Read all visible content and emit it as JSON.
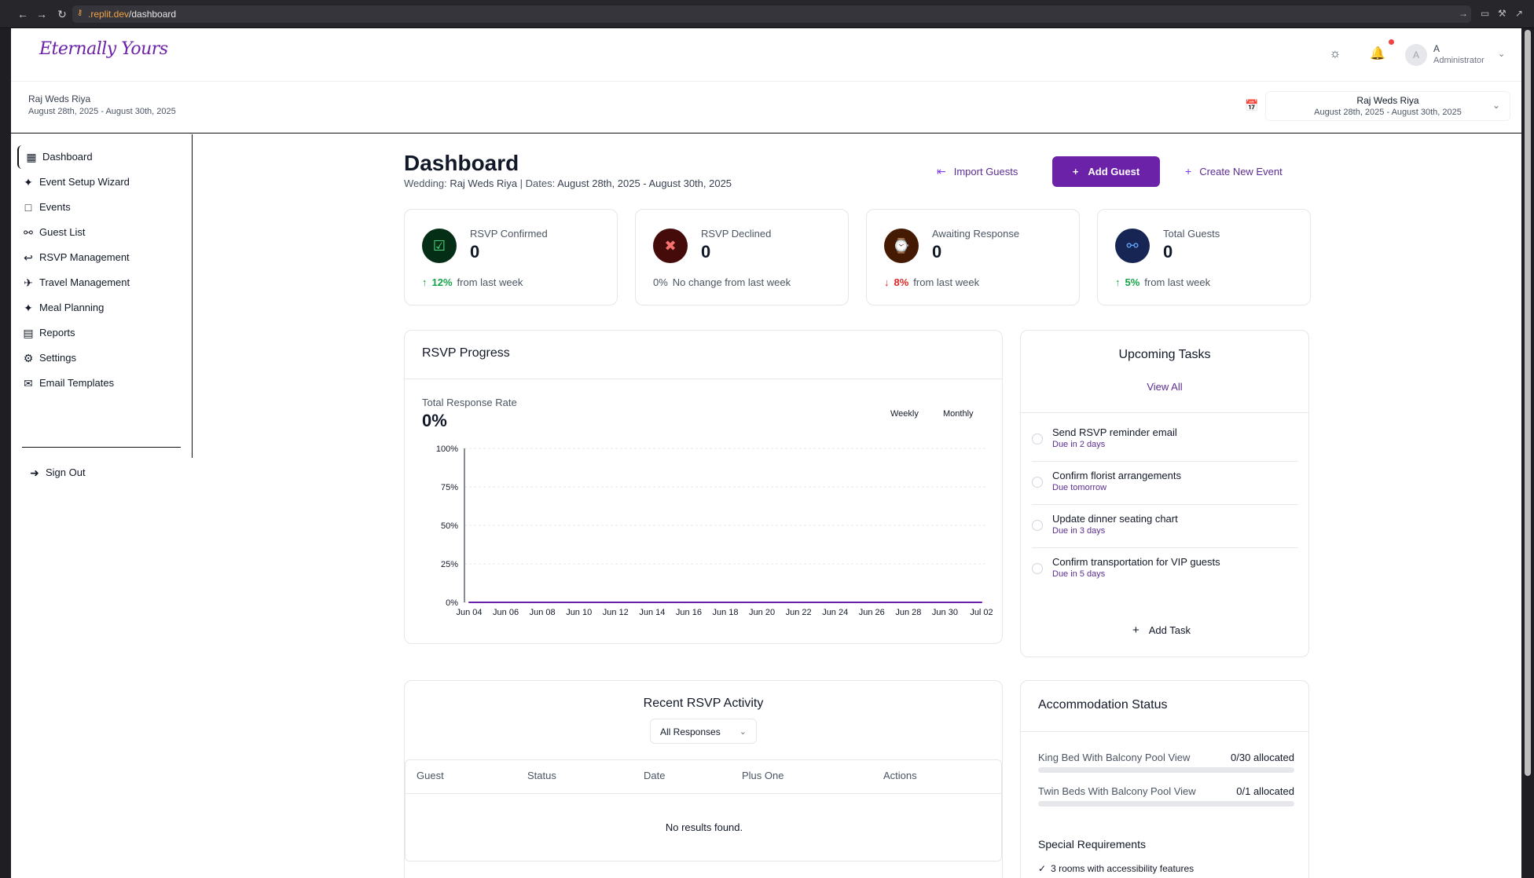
{
  "browser": {
    "url_domain": ".replit.dev",
    "url_path": "/dashboard"
  },
  "header": {
    "logo": "Eternally Yours",
    "user_initial": "A",
    "user_name": "A",
    "user_role": "Administrator"
  },
  "event": {
    "title": "Raj Weds Riya",
    "dates": "August 28th, 2025 - August 30th, 2025",
    "selector_title": "Raj Weds Riya",
    "selector_dates": "August 28th, 2025 - August 30th, 2025"
  },
  "sidebar": {
    "items": [
      {
        "label": "Dashboard",
        "icon": "grid-icon"
      },
      {
        "label": "Event Setup Wizard",
        "icon": "wand-icon"
      },
      {
        "label": "Events",
        "icon": "calendar-icon"
      },
      {
        "label": "Guest List",
        "icon": "users-icon"
      },
      {
        "label": "RSVP Management",
        "icon": "reply-icon"
      },
      {
        "label": "Travel Management",
        "icon": "plane-icon"
      },
      {
        "label": "Meal Planning",
        "icon": "utensils-icon"
      },
      {
        "label": "Reports",
        "icon": "report-icon"
      },
      {
        "label": "Settings",
        "icon": "gear-icon"
      },
      {
        "label": "Email Templates",
        "icon": "mail-icon"
      }
    ],
    "sign_out": "Sign Out"
  },
  "page": {
    "title": "Dashboard",
    "wedding_prefix": "Wedding:",
    "wedding_name": "Raj Weds Riya",
    "dates_prefix": "| Dates:",
    "dates_value": "August 28th, 2025 - August 30th, 2025",
    "import_guests": "Import Guests",
    "add_guest": "Add Guest",
    "create_event": "Create New Event"
  },
  "stats": [
    {
      "label": "RSVP Confirmed",
      "value": "0",
      "change": "12%",
      "trend": "up",
      "note": "from last week",
      "color": "#166534",
      "bg": "#052e16",
      "icon": "user-check-icon"
    },
    {
      "label": "RSVP Declined",
      "value": "0",
      "change": "0%",
      "trend": "flat",
      "note": "No change from last week",
      "color": "#f87171",
      "bg": "#450a0a",
      "icon": "user-x-icon"
    },
    {
      "label": "Awaiting Response",
      "value": "0",
      "change": "8%",
      "trend": "down",
      "note": "from last week",
      "color": "#f59e0b",
      "bg": "#451a03",
      "icon": "watch-icon"
    },
    {
      "label": "Total Guests",
      "value": "0",
      "change": "5%",
      "trend": "up",
      "note": "from last week",
      "color": "#60a5fa",
      "bg": "#172554",
      "icon": "users-icon"
    }
  ],
  "rsvp_progress": {
    "title": "RSVP Progress",
    "rate_label": "Total Response Rate",
    "rate_value": "0%",
    "weekly": "Weekly",
    "monthly": "Monthly"
  },
  "chart_data": {
    "type": "line",
    "title": "",
    "xlabel": "",
    "ylabel": "",
    "categories": [
      "Jun 04",
      "Jun 06",
      "Jun 08",
      "Jun 10",
      "Jun 12",
      "Jun 14",
      "Jun 16",
      "Jun 18",
      "Jun 20",
      "Jun 22",
      "Jun 24",
      "Jun 26",
      "Jun 28",
      "Jun 30",
      "Jul 02"
    ],
    "values": [
      0,
      0,
      0,
      0,
      0,
      0,
      0,
      0,
      0,
      0,
      0,
      0,
      0,
      0,
      0
    ],
    "yticks": [
      "100%",
      "75%",
      "50%",
      "25%",
      "0%"
    ],
    "ylim": [
      0,
      100
    ],
    "grid": true,
    "line_color": "#6b21a8"
  },
  "tasks": {
    "title": "Upcoming Tasks",
    "view_all": "View All",
    "items": [
      {
        "title": "Send RSVP reminder email",
        "due": "Due in 2 days"
      },
      {
        "title": "Confirm florist arrangements",
        "due": "Due tomorrow"
      },
      {
        "title": "Update dinner seating chart",
        "due": "Due in 3 days"
      },
      {
        "title": "Confirm transportation for VIP guests",
        "due": "Due in 5 days"
      }
    ],
    "add_task": "Add Task"
  },
  "activity": {
    "title": "Recent RSVP Activity",
    "filter": "All Responses",
    "columns": [
      "Guest",
      "Status",
      "Date",
      "Plus One",
      "Actions"
    ],
    "empty": "No results found."
  },
  "accommodation": {
    "title": "Accommodation Status",
    "rooms": [
      {
        "name": "King Bed With Balcony Pool View",
        "allocated": "0/30 allocated",
        "fraction": 0
      },
      {
        "name": "Twin Beds With Balcony Pool View",
        "allocated": "0/1 allocated",
        "fraction": 0
      }
    ],
    "special_title": "Special Requirements",
    "special_items": [
      "3 rooms with accessibility features"
    ]
  }
}
